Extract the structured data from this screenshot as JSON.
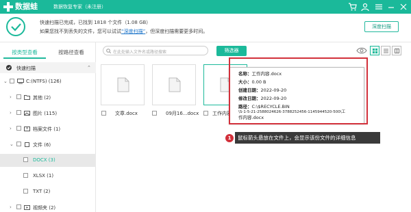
{
  "app": {
    "name": "数据蛙",
    "title": "数据恢复专家（未注册）"
  },
  "status": {
    "line1": "快速扫描已完成，已找到 1818 个文件（1.08 GB）",
    "line2_prefix": "如果您找不到丢失的文件，您可以试试",
    "line2_link": "“深度扫描”",
    "line2_suffix": "，但深度扫描需要更多时间。",
    "deep_scan_button": "深度扫描"
  },
  "left_tabs": {
    "by_type": "按类型查看",
    "by_path": "按路径查看"
  },
  "quick_scan": "快速扫描",
  "tree": [
    {
      "label": "C:(NTFS) (126)"
    },
    {
      "label": "其他 (2)"
    },
    {
      "label": "图片 (115)"
    },
    {
      "label": "档案文件 (1)"
    },
    {
      "label": "文件 (6)"
    },
    {
      "label": "DOCX (3)"
    },
    {
      "label": "XLSX (1)"
    },
    {
      "label": "TXT (2)"
    },
    {
      "label": "视频夹 (2)"
    }
  ],
  "toolbar": {
    "search_placeholder": "在此处输入文件名或路径搜索",
    "filter_button": "筛选器"
  },
  "files": [
    {
      "name": "文章.docx"
    },
    {
      "name": "09月16...docx"
    },
    {
      "name": "工作内容.docx"
    }
  ],
  "tooltip": {
    "name_label": "名称：",
    "name_value": "工作内容.docx",
    "size_label": "大小：",
    "size_value": "0.00 B",
    "created_label": "创建日期：",
    "created_value": "2022-09-20",
    "modified_label": "修改日期：",
    "modified_value": "2022-09-20",
    "path_label": "路径：",
    "path_value_1": "C:\\$RECYCLE.BIN",
    "path_value_2": "\\S-1-5-21-2588024626-3788252456-1145944520-500\\工",
    "path_value_3": "作内容.docx"
  },
  "callout": {
    "badge": "1",
    "text": "鼠标箭头悬放在文件上，会显示该份文件的详细信息"
  },
  "colors": {
    "accent": "#1bb99a",
    "highlight": "#d2303a"
  }
}
